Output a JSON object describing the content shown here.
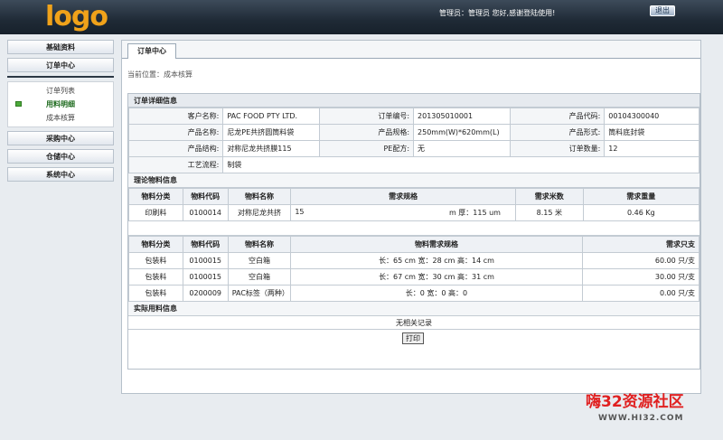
{
  "header": {
    "logo": "logo",
    "message": "管理员：管理员  您好,感谢登陆使用!",
    "logout_label": "退出"
  },
  "sidebar": {
    "items": [
      {
        "label": "基础资料"
      },
      {
        "label": "订单中心"
      },
      {
        "label": "采购中心"
      },
      {
        "label": "仓储中心"
      },
      {
        "label": "系统中心"
      }
    ],
    "sub_items": [
      {
        "label": "订单列表"
      },
      {
        "label": "用料明细"
      },
      {
        "label": "成本核算"
      }
    ]
  },
  "main": {
    "tab": "订单中心",
    "breadcrumb": "当前位置：成本核算"
  },
  "order": {
    "section_title": "订单详细信息",
    "customer_label": "客户名称:",
    "customer": "PAC FOOD PTY LTD.",
    "order_no_label": "订单编号:",
    "order_no": "201305010001",
    "product_code_label": "产品代码:",
    "product_code": "00104300040",
    "product_name_label": "产品名称:",
    "product_name": "尼龙PE共挤圆筒料袋",
    "product_spec_label": "产品规格:",
    "product_spec": "250mm(W)*620mm(L)",
    "product_form_label": "产品形式:",
    "product_form": "筒料底封袋",
    "product_struct_label": "产品结构:",
    "product_struct": "对称尼龙共挤膜115",
    "pe_label": "PE配方:",
    "pe": "无",
    "qty_label": "订单数量:",
    "qty": "12",
    "process_label": "工艺流程:",
    "process": "制袋"
  },
  "theory": {
    "title": "理论物料信息",
    "headers": [
      "物料分类",
      "物料代码",
      "物料名称",
      "需求规格",
      "需求米数",
      "需求重量"
    ],
    "rows": [
      {
        "cat": "印刷料",
        "code": "0100014",
        "name": "对称尼龙共挤",
        "name_b": "15",
        "spec": "m 厚：115 um",
        "meters": "8.15 米",
        "weight": "0.46 Kg"
      }
    ]
  },
  "materials": {
    "headers": [
      "物料分类",
      "物料代码",
      "物料名称",
      "物料需求规格",
      "需求只支"
    ],
    "rows": [
      {
        "cat": "包装料",
        "code": "0100015",
        "name": "空白箱",
        "spec": "长：65 cm 宽：28 cm 高：14 cm",
        "qty": "60.00 只/支"
      },
      {
        "cat": "包装料",
        "code": "0100015",
        "name": "空白箱",
        "spec": "长：67 cm 宽：30 cm 高：31 cm",
        "qty": "30.00 只/支"
      },
      {
        "cat": "包装料",
        "code": "0200009",
        "name": "PAC标签（两种）",
        "spec": "长：0 宽：0 高：0",
        "qty": "0.00 只/支"
      }
    ]
  },
  "actual": {
    "title": "实际用料信息",
    "empty": "无相关记录"
  },
  "print_label": "打印",
  "watermark": {
    "text": "嗨32资源社区",
    "url": "WWW.HI32.COM"
  },
  "colors": {
    "header_dark": "#1f2a36",
    "logo": "#f0a21a",
    "active_green": "#1d6a1d"
  }
}
